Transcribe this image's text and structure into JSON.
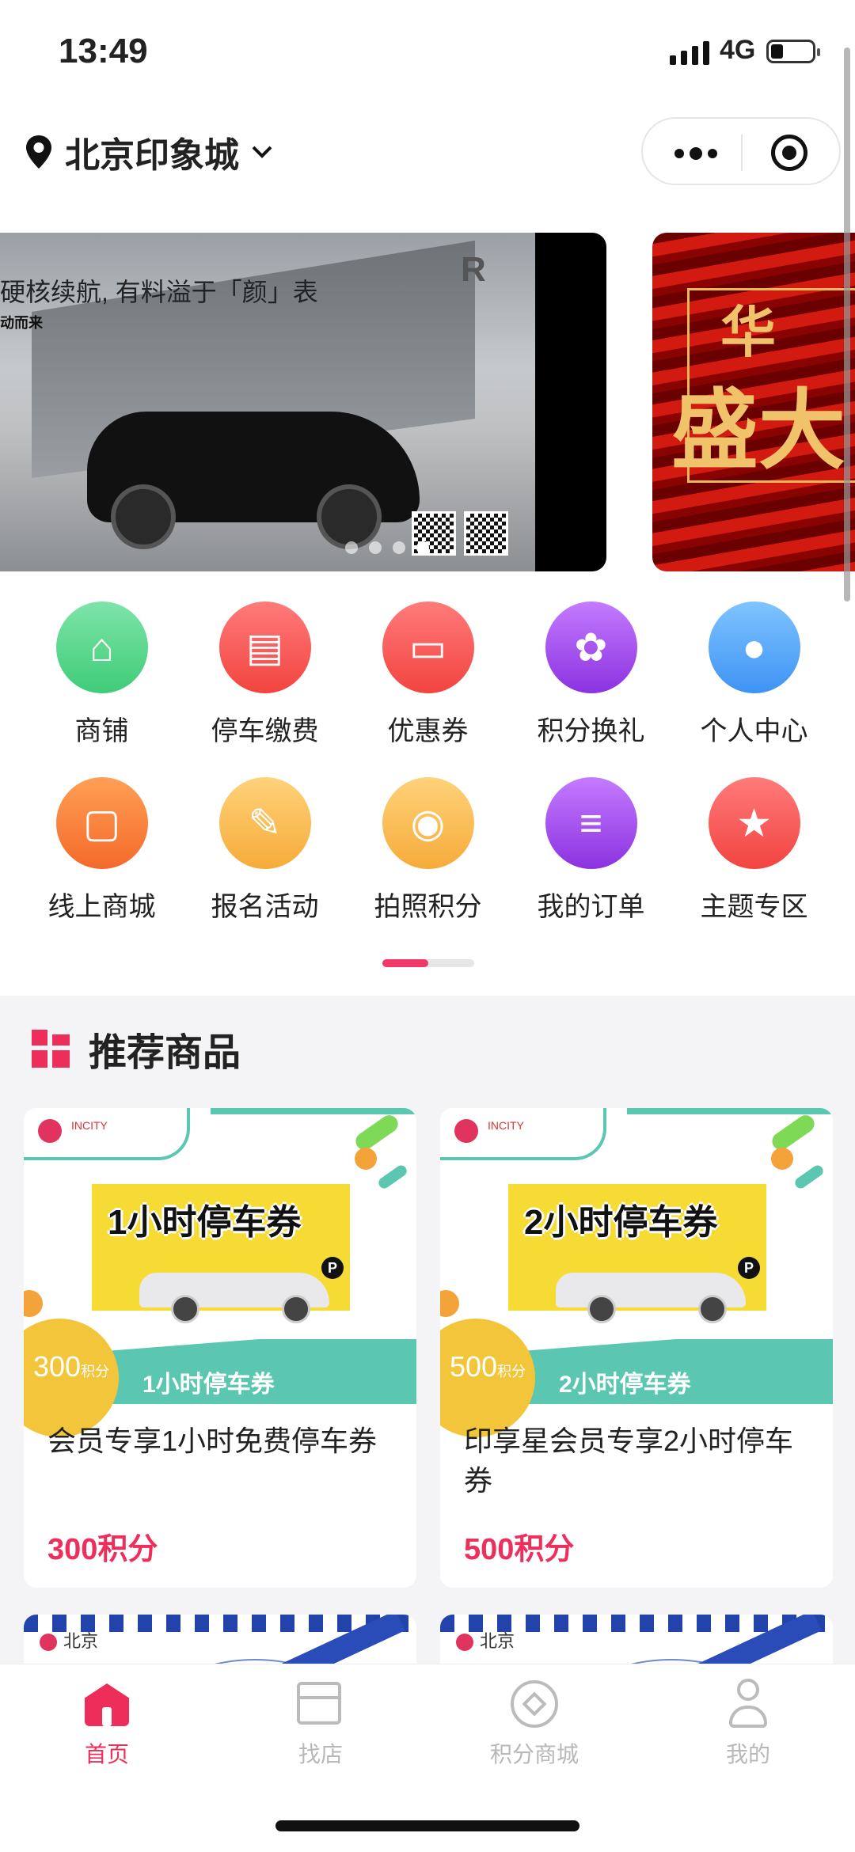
{
  "status_bar": {
    "time": "13:49",
    "network": "4G",
    "battery_level": 0.3
  },
  "header": {
    "location": "北京印象城"
  },
  "banners": [
    {
      "headline": "硬核续航, 有料溢于「颜」表",
      "subline": "动而来",
      "brand": "R"
    },
    {
      "line1": "华",
      "line2": "盛大"
    }
  ],
  "banner_dots": {
    "count": 4,
    "active_index": 3
  },
  "grid": {
    "items": [
      {
        "label": "商铺",
        "icon": "store-icon",
        "color": "green",
        "glyph": "⌂"
      },
      {
        "label": "停车缴费",
        "icon": "car-icon",
        "color": "red",
        "glyph": "▤"
      },
      {
        "label": "优惠券",
        "icon": "coupon-icon",
        "color": "red",
        "glyph": "▭"
      },
      {
        "label": "积分换礼",
        "icon": "tulip-icon",
        "color": "purple",
        "glyph": "✿"
      },
      {
        "label": "个人中心",
        "icon": "user-icon",
        "color": "blue",
        "glyph": "●"
      },
      {
        "label": "线上商城",
        "icon": "shopping-bag-icon",
        "color": "orange",
        "glyph": "▢"
      },
      {
        "label": "报名活动",
        "icon": "feather-icon",
        "color": "yellow",
        "glyph": "✎"
      },
      {
        "label": "拍照积分",
        "icon": "camera-icon",
        "color": "yellow",
        "glyph": "◉"
      },
      {
        "label": "我的订单",
        "icon": "order-icon",
        "color": "purple",
        "glyph": "≡"
      },
      {
        "label": "主题专区",
        "icon": "star-icon",
        "color": "red",
        "glyph": "★"
      }
    ],
    "page_indicator": {
      "pages": 2,
      "active": 0
    }
  },
  "recommend": {
    "title": "推荐商品",
    "products": [
      {
        "poster_text": "1小时停车券",
        "points_badge": "300",
        "points_unit": "积分",
        "band_text": "1小时停车券",
        "name": "会员专享1小时免费停车券",
        "price": "300积分"
      },
      {
        "poster_text": "2小时停车券",
        "points_badge": "500",
        "points_unit": "积分",
        "band_text": "2小时停车券",
        "name": "印享星会员专享2小时停车券",
        "price": "500积分"
      }
    ],
    "peek_label": "北京"
  },
  "tabbar": {
    "tabs": [
      {
        "label": "首页",
        "icon": "home-icon",
        "active": true
      },
      {
        "label": "找店",
        "icon": "shop-icon",
        "active": false
      },
      {
        "label": "积分商城",
        "icon": "points-mall-icon",
        "active": false
      },
      {
        "label": "我的",
        "icon": "profile-icon",
        "active": false
      }
    ]
  },
  "colors": {
    "accent": "#ee2e5a",
    "teal": "#5bc7b0",
    "inactive": "#b8b8b8"
  }
}
